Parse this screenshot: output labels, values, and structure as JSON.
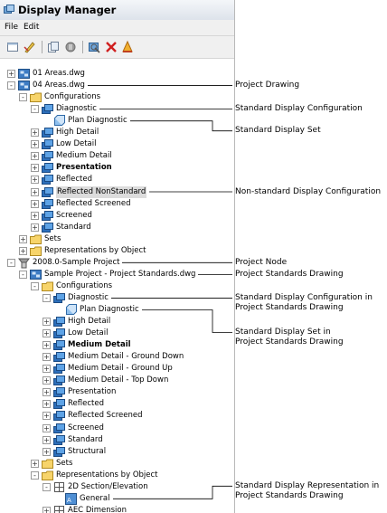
{
  "window": {
    "title": "Display Manager",
    "menu": [
      "File",
      "Edit"
    ],
    "toolbar_icons": [
      "new-icon",
      "edit-icon",
      "copy-icon",
      "paste-icon",
      "purge-icon",
      "delete-icon",
      "clean-icon"
    ]
  },
  "tree": {
    "items": [
      {
        "label": "01 Areas.dwg",
        "icon": "drawing",
        "level": 0,
        "exp": "+",
        "bold": false,
        "selected": false
      },
      {
        "label": "04 Areas.dwg",
        "icon": "drawing",
        "level": 0,
        "exp": "-",
        "bold": false,
        "selected": false
      },
      {
        "label": "Configurations",
        "icon": "folder",
        "level": 1,
        "exp": "-",
        "bold": false,
        "selected": false
      },
      {
        "label": "Diagnostic",
        "icon": "config",
        "level": 2,
        "exp": "-",
        "bold": false,
        "selected": false
      },
      {
        "label": "Plan Diagnostic",
        "icon": "set",
        "level": 3,
        "exp": "",
        "bold": false,
        "selected": false
      },
      {
        "label": "High Detail",
        "icon": "config",
        "level": 2,
        "exp": "+",
        "bold": false,
        "selected": false
      },
      {
        "label": "Low Detail",
        "icon": "config",
        "level": 2,
        "exp": "+",
        "bold": false,
        "selected": false
      },
      {
        "label": "Medium Detail",
        "icon": "config",
        "level": 2,
        "exp": "+",
        "bold": false,
        "selected": false
      },
      {
        "label": "Presentation",
        "icon": "config",
        "level": 2,
        "exp": "+",
        "bold": true,
        "selected": false
      },
      {
        "label": "Reflected",
        "icon": "config",
        "level": 2,
        "exp": "+",
        "bold": false,
        "selected": false
      },
      {
        "label": "Reflected NonStandard",
        "icon": "config",
        "level": 2,
        "exp": "+",
        "bold": false,
        "selected": true
      },
      {
        "label": "Reflected Screened",
        "icon": "config",
        "level": 2,
        "exp": "+",
        "bold": false,
        "selected": false
      },
      {
        "label": "Screened",
        "icon": "config",
        "level": 2,
        "exp": "+",
        "bold": false,
        "selected": false
      },
      {
        "label": "Standard",
        "icon": "config",
        "level": 2,
        "exp": "+",
        "bold": false,
        "selected": false
      },
      {
        "label": "Sets",
        "icon": "folder",
        "level": 1,
        "exp": "+",
        "bold": false,
        "selected": false
      },
      {
        "label": "Representations by Object",
        "icon": "folder",
        "level": 1,
        "exp": "+",
        "bold": false,
        "selected": false
      },
      {
        "label": "2008.0-Sample Project",
        "icon": "project",
        "level": 0,
        "exp": "-",
        "bold": false,
        "selected": false
      },
      {
        "label": "Sample Project - Project Standards.dwg",
        "icon": "drawing",
        "level": 1,
        "exp": "-",
        "bold": false,
        "selected": false
      },
      {
        "label": "Configurations",
        "icon": "folder",
        "level": 2,
        "exp": "-",
        "bold": false,
        "selected": false
      },
      {
        "label": "Diagnostic",
        "icon": "config",
        "level": 3,
        "exp": "-",
        "bold": false,
        "selected": false
      },
      {
        "label": "Plan Diagnostic",
        "icon": "set",
        "level": 4,
        "exp": "",
        "bold": false,
        "selected": false
      },
      {
        "label": "High Detail",
        "icon": "config",
        "level": 3,
        "exp": "+",
        "bold": false,
        "selected": false
      },
      {
        "label": "Low Detail",
        "icon": "config",
        "level": 3,
        "exp": "+",
        "bold": false,
        "selected": false
      },
      {
        "label": "Medium Detail",
        "icon": "config",
        "level": 3,
        "exp": "+",
        "bold": true,
        "selected": false
      },
      {
        "label": "Medium Detail - Ground Down",
        "icon": "config",
        "level": 3,
        "exp": "+",
        "bold": false,
        "selected": false
      },
      {
        "label": "Medium Detail - Ground Up",
        "icon": "config",
        "level": 3,
        "exp": "+",
        "bold": false,
        "selected": false
      },
      {
        "label": "Medium Detail - Top Down",
        "icon": "config",
        "level": 3,
        "exp": "+",
        "bold": false,
        "selected": false
      },
      {
        "label": "Presentation",
        "icon": "config",
        "level": 3,
        "exp": "+",
        "bold": false,
        "selected": false
      },
      {
        "label": "Reflected",
        "icon": "config",
        "level": 3,
        "exp": "+",
        "bold": false,
        "selected": false
      },
      {
        "label": "Reflected Screened",
        "icon": "config",
        "level": 3,
        "exp": "+",
        "bold": false,
        "selected": false
      },
      {
        "label": "Screened",
        "icon": "config",
        "level": 3,
        "exp": "+",
        "bold": false,
        "selected": false
      },
      {
        "label": "Standard",
        "icon": "config",
        "level": 3,
        "exp": "+",
        "bold": false,
        "selected": false
      },
      {
        "label": "Structural",
        "icon": "config",
        "level": 3,
        "exp": "+",
        "bold": false,
        "selected": false
      },
      {
        "label": "Sets",
        "icon": "folder",
        "level": 2,
        "exp": "+",
        "bold": false,
        "selected": false
      },
      {
        "label": "Representations by Object",
        "icon": "folder",
        "level": 2,
        "exp": "-",
        "bold": false,
        "selected": false
      },
      {
        "label": "2D Section/Elevation",
        "icon": "object",
        "level": 3,
        "exp": "-",
        "bold": false,
        "selected": false
      },
      {
        "label": "General",
        "icon": "rep",
        "level": 4,
        "exp": "",
        "bold": false,
        "selected": false
      },
      {
        "label": "AEC Dimension",
        "icon": "object",
        "level": 3,
        "exp": "+",
        "bold": false,
        "selected": false
      }
    ]
  },
  "annotations": [
    {
      "text": "Project Drawing",
      "row": 1
    },
    {
      "text": "Standard Display Configuration",
      "row": 3
    },
    {
      "text": "Standard Display Set",
      "row": 4
    },
    {
      "text": "Non-standard Display Configuration",
      "row": 10
    },
    {
      "text": "Project Node",
      "row": 16
    },
    {
      "text": "Project Standards Drawing",
      "row": 17
    },
    {
      "text": "Standard Display Configuration in\nProject Standards Drawing",
      "row": 19
    },
    {
      "text": "Standard Display Set in\nProject Standards Drawing",
      "row": 20
    },
    {
      "text": "Standard Display Representation in\nProject Standards Drawing",
      "row": 36
    }
  ]
}
